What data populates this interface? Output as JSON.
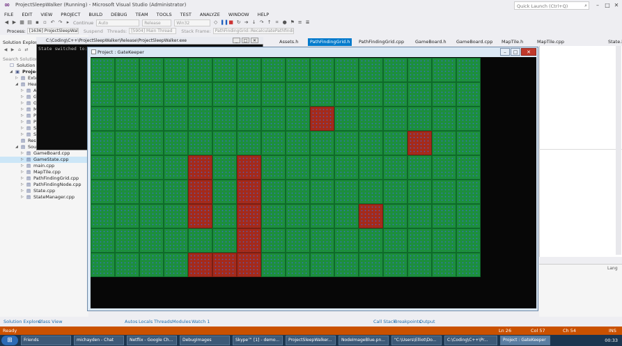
{
  "vs": {
    "title": "ProjectSleepWalker (Running) - Microsoft Visual Studio (Administrator)",
    "quick_launch_placeholder": "Quick Launch (Ctrl+Q)",
    "menu": [
      "FILE",
      "EDIT",
      "VIEW",
      "PROJECT",
      "BUILD",
      "DEBUG",
      "TEAM",
      "TOOLS",
      "TEST",
      "ANALYZE",
      "WINDOW",
      "HELP"
    ],
    "toolbar": {
      "continue": "Continue",
      "config1": "Auto",
      "config2": "Release",
      "platform": "Win32"
    },
    "procbar": {
      "process_label": "Process:",
      "process_value": "[1636] ProjectSleepWalker.exe",
      "suspend": "Suspend",
      "threads_label": "Threads:",
      "thread_value": "[5904] Main Thread",
      "stack_label": "Stack Frame:",
      "stack_value": "PathFindingGrid::RecalculatePathfinding"
    }
  },
  "solution_explorer": {
    "title": "Solution Explorer",
    "search": "Search Solution E",
    "tree": [
      {
        "label": "Solution 'Pr",
        "level": 0,
        "arrow": "",
        "icon": "☐"
      },
      {
        "label": "ProjectS",
        "level": 1,
        "arrow": "◢",
        "icon": "▣",
        "bold": true
      },
      {
        "label": "Exter",
        "level": 2,
        "arrow": "▷",
        "icon": "▤"
      },
      {
        "label": "Head",
        "level": 2,
        "arrow": "◢",
        "icon": "▤"
      },
      {
        "label": "A",
        "level": 3,
        "arrow": "▷",
        "icon": "▤"
      },
      {
        "label": "G",
        "level": 3,
        "arrow": "▷",
        "icon": "▤"
      },
      {
        "label": "G",
        "level": 3,
        "arrow": "▷",
        "icon": "▤"
      },
      {
        "label": "M",
        "level": 3,
        "arrow": "▷",
        "icon": "▤"
      },
      {
        "label": "P",
        "level": 3,
        "arrow": "▷",
        "icon": "▤"
      },
      {
        "label": "P",
        "level": 3,
        "arrow": "▷",
        "icon": "▤"
      },
      {
        "label": "S",
        "level": 3,
        "arrow": "▷",
        "icon": "▤"
      },
      {
        "label": "S",
        "level": 3,
        "arrow": "▷",
        "icon": "▤"
      },
      {
        "label": "Reso",
        "level": 2,
        "arrow": "",
        "icon": "▤"
      },
      {
        "label": "Sourc",
        "level": 2,
        "arrow": "◢",
        "icon": "▤"
      },
      {
        "label": "GameBoard.cpp",
        "level": 3,
        "arrow": "▷",
        "icon": "▤"
      },
      {
        "label": "GameState.cpp",
        "level": 3,
        "arrow": "▷",
        "icon": "▤",
        "selected": true
      },
      {
        "label": "main.cpp",
        "level": 3,
        "arrow": "▷",
        "icon": "▤"
      },
      {
        "label": "MapTile.cpp",
        "level": 3,
        "arrow": "▷",
        "icon": "▤"
      },
      {
        "label": "PathFindingGrid.cpp",
        "level": 3,
        "arrow": "▷",
        "icon": "▤"
      },
      {
        "label": "PathFindingNode.cpp",
        "level": 3,
        "arrow": "▷",
        "icon": "▤"
      },
      {
        "label": "State.cpp",
        "level": 3,
        "arrow": "▷",
        "icon": "▤"
      },
      {
        "label": "StateManager.cpp",
        "level": 3,
        "arrow": "▷",
        "icon": "▤"
      }
    ]
  },
  "editor_tabs": [
    {
      "label": "Assets.h",
      "active": false
    },
    {
      "label": "PathFindingGrid.h",
      "active": true
    },
    {
      "label": "PathFindingGrid.cpp",
      "active": false
    },
    {
      "label": "GameBoard.h",
      "active": false
    },
    {
      "label": "GameBoard.cpp",
      "active": false
    },
    {
      "label": "MapTile.h",
      "active": false
    },
    {
      "label": "MapTile.cpp",
      "active": false
    },
    {
      "label": "State.h",
      "active": false
    }
  ],
  "console": {
    "title": "C:\\Coding\\C++\\ProjectSleepWalker\\Release\\ProjectSleepWalker.exe",
    "text": "State switched to: Game State"
  },
  "game": {
    "title": "Project : GateKeeper",
    "cols": 16,
    "rows": 9,
    "walls": [
      [
        9,
        2
      ],
      [
        13,
        3
      ],
      [
        4,
        4
      ],
      [
        6,
        4
      ],
      [
        4,
        5
      ],
      [
        6,
        5
      ],
      [
        4,
        6
      ],
      [
        6,
        6
      ],
      [
        11,
        6
      ],
      [
        6,
        7
      ],
      [
        4,
        8
      ],
      [
        5,
        8
      ],
      [
        6,
        8
      ]
    ],
    "colors": {
      "walkable": "#1c8f3c",
      "wall": "#a52a1a",
      "background": "#070707"
    }
  },
  "locals_partial": "Lang",
  "bottom_tabs_left": [
    "Solution Explorer",
    "Class View"
  ],
  "bottom_tabs_mid": [
    "Autos",
    "Locals",
    "Threads",
    "Modules",
    "Watch 1"
  ],
  "bottom_tabs_right": [
    "Call Stack",
    "Breakpoints",
    "Output"
  ],
  "status": {
    "ready": "Ready",
    "ln": "Ln 26",
    "col": "Col 57",
    "ch": "Ch 54",
    "ins": "INS"
  },
  "taskbar": {
    "apps": [
      {
        "label": "Friends",
        "active": false
      },
      {
        "label": "michayden - Chat",
        "active": false
      },
      {
        "label": "Netflix - Google Ch...",
        "active": false
      },
      {
        "label": "DebugImages",
        "active": false
      },
      {
        "label": "Skype™ [1] - demo...",
        "active": false
      },
      {
        "label": "ProjectSleepWalker...",
        "active": false
      },
      {
        "label": "NodeImageBlue.pn...",
        "active": false
      },
      {
        "label": "\"C:\\Users\\Elliot\\Do...",
        "active": false
      },
      {
        "label": "C:\\Coding\\C++\\Pr...",
        "active": false
      },
      {
        "label": "Project : GateKeeper",
        "active": true
      }
    ],
    "clock": "00:33"
  }
}
